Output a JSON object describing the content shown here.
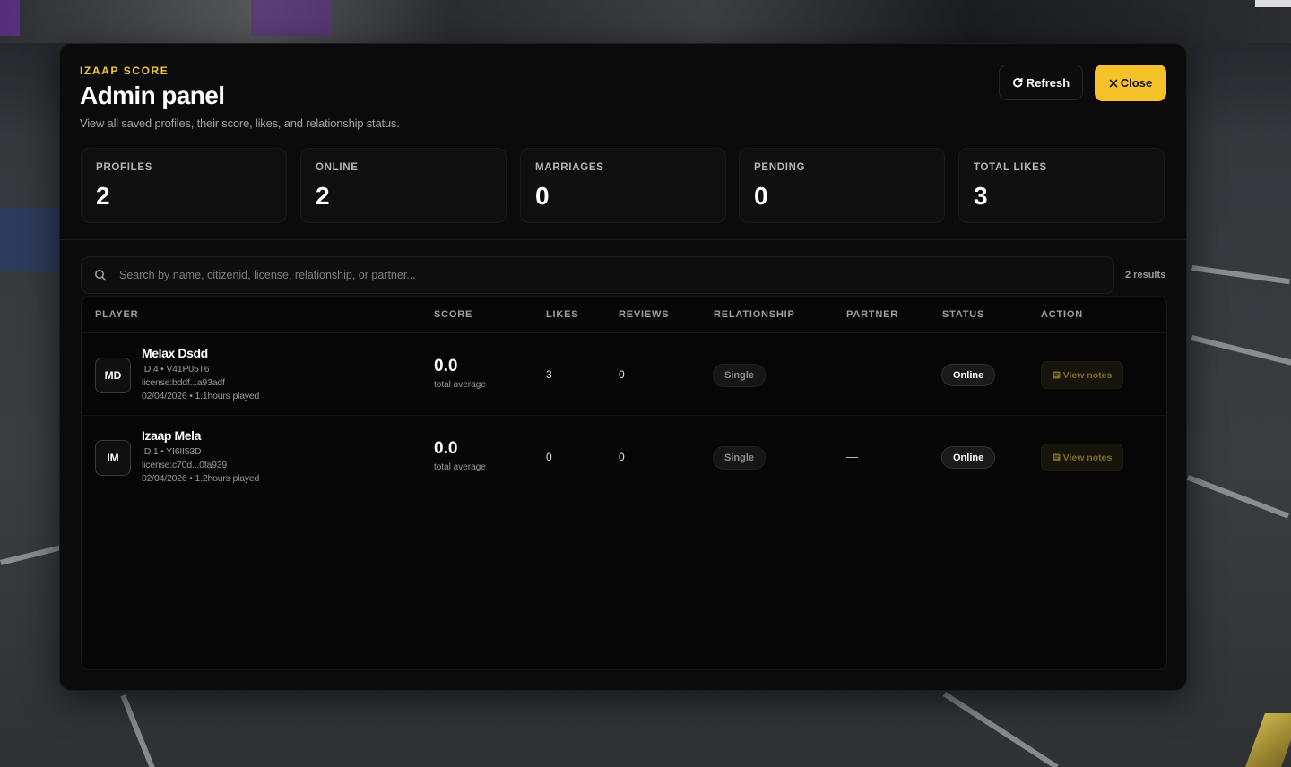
{
  "header": {
    "eyebrow": "IZAAP SCORE",
    "title": "Admin panel",
    "subtitle": "View all saved profiles, their score, likes, and relationship status.",
    "refresh_label": "Refresh",
    "close_label": "Close"
  },
  "stats": [
    {
      "label": "PROFILES",
      "value": "2"
    },
    {
      "label": "ONLINE",
      "value": "2"
    },
    {
      "label": "MARRIAGES",
      "value": "0"
    },
    {
      "label": "PENDING",
      "value": "0"
    },
    {
      "label": "TOTAL LIKES",
      "value": "3"
    }
  ],
  "search": {
    "placeholder": "Search by name, citizenid, license, relationship, or partner...",
    "results": "2 results"
  },
  "table": {
    "columns": [
      "PLAYER",
      "SCORE",
      "LIKES",
      "REVIEWS",
      "RELATIONSHIP",
      "PARTNER",
      "STATUS",
      "ACTION"
    ],
    "rows": [
      {
        "initials": "MD",
        "name": "Melax Dsdd",
        "id_line": "ID 4 • V41P05T6",
        "license": "license:bddf...a93adf",
        "date_line": "02/04/2026 • 1.1hours played",
        "score": "0.0",
        "score_label": "total average",
        "likes": "3",
        "reviews": "0",
        "relationship": "Single",
        "partner": "—",
        "status": "Online",
        "action": "View notes"
      },
      {
        "initials": "IM",
        "name": "Izaap Mela",
        "id_line": "ID 1 • YI6II53D",
        "license": "license:c70d...0fa939",
        "date_line": "02/04/2026 • 1.2hours played",
        "score": "0.0",
        "score_label": "total average",
        "likes": "0",
        "reviews": "0",
        "relationship": "Single",
        "partner": "—",
        "status": "Online",
        "action": "View notes"
      }
    ]
  },
  "colors": {
    "accent": "#f5c22a",
    "panel_bg": "#0b0b0b",
    "notes_text": "#7b6a24"
  },
  "icons": {
    "refresh": "refresh-icon",
    "close": "close-icon",
    "search": "search-icon",
    "notes": "note-icon"
  }
}
